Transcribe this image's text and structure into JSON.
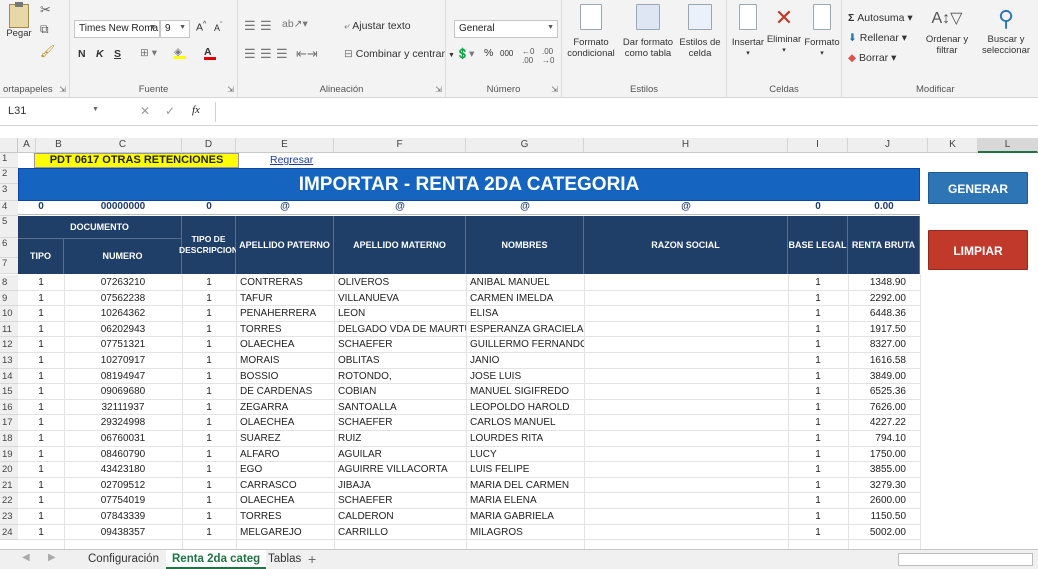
{
  "ribbon": {
    "clipboard": {
      "paste": "Pegar",
      "group": "ortapapeles"
    },
    "font": {
      "name": "Times New Roma",
      "size": "9",
      "bold": "N",
      "italic": "K",
      "underline": "S",
      "group": "Fuente"
    },
    "alignment": {
      "wrap": "Ajustar texto",
      "merge": "Combinar y centrar",
      "group": "Alineación"
    },
    "number": {
      "format": "General",
      "percent": "%",
      "thousands": "000",
      "group": "Número"
    },
    "styles": {
      "conditional": "Formato\ncondicional",
      "as_table": "Dar formato\ncomo tabla",
      "cell_styles": "Estilos de\ncelda",
      "group": "Estilos"
    },
    "cells": {
      "insert": "Insertar",
      "delete": "Eliminar",
      "format": "Formato",
      "group": "Celdas"
    },
    "editing": {
      "autosum": "Autosuma",
      "fill": "Rellenar",
      "clear": "Borrar",
      "sort": "Ordenar y\nfiltrar",
      "find": "Buscar y\nseleccionar",
      "group": "Modificar"
    }
  },
  "formula_bar": {
    "name_box": "L31",
    "fx": "fx"
  },
  "columns": [
    "A",
    "B",
    "C",
    "D",
    "E",
    "F",
    "G",
    "H",
    "I",
    "J",
    "K",
    "L"
  ],
  "sheet": {
    "pdt_title": "PDT 0617 OTRAS RETENCIONES",
    "regresar": "Regresar",
    "banner": "IMPORTAR - RENTA 2DA CATEGORIA",
    "row4": [
      "0",
      "00000000",
      "0",
      "@",
      "@",
      "@",
      "@",
      "0",
      "0.00"
    ],
    "headers": {
      "documento": "DOCUMENTO",
      "tipo": "TIPO",
      "numero": "NUMERO",
      "tipo_desc": "TIPO DE DESCRIPCION",
      "ap_paterno": "APELLIDO PATERNO",
      "ap_materno": "APELLIDO MATERNO",
      "nombres": "NOMBRES",
      "razon": "RAZON SOCIAL",
      "base": "BASE LEGAL",
      "renta": "RENTA BRUTA"
    },
    "buttons": {
      "generar": "GENERAR",
      "limpiar": "LIMPIAR"
    },
    "rows": [
      {
        "n": "8",
        "tipo": "1",
        "num": "07263210",
        "desc": "1",
        "pat": "CONTRERAS",
        "mat": "OLIVEROS",
        "nom": "ANIBAL MANUEL",
        "base": "1",
        "renta": "1348.90"
      },
      {
        "n": "9",
        "tipo": "1",
        "num": "07562238",
        "desc": "1",
        "pat": "TAFUR",
        "mat": "VILLANUEVA",
        "nom": "CARMEN IMELDA",
        "base": "1",
        "renta": "2292.00"
      },
      {
        "n": "10",
        "tipo": "1",
        "num": "10264362",
        "desc": "1",
        "pat": "PEÑAHERRERA",
        "mat": "LEON",
        "nom": "ELISA",
        "base": "1",
        "renta": "6448.36"
      },
      {
        "n": "11",
        "tipo": "1",
        "num": "06202943",
        "desc": "1",
        "pat": "TORRES",
        "mat": "DELGADO VDA DE MAURTUA",
        "nom": "ESPERANZA GRACIELA",
        "base": "1",
        "renta": "1917.50"
      },
      {
        "n": "12",
        "tipo": "1",
        "num": "07751321",
        "desc": "1",
        "pat": "OLAECHEA",
        "mat": "SCHAEFER",
        "nom": "GUILLERMO FERNANDO",
        "base": "1",
        "renta": "8327.00"
      },
      {
        "n": "13",
        "tipo": "1",
        "num": "10270917",
        "desc": "1",
        "pat": "MORAIS",
        "mat": "OBLITAS",
        "nom": "JANIO",
        "base": "1",
        "renta": "1616.58"
      },
      {
        "n": "14",
        "tipo": "1",
        "num": "08194947",
        "desc": "1",
        "pat": "BOSSIO",
        "mat": "ROTONDO,",
        "nom": "JOSE LUIS",
        "base": "1",
        "renta": "3849.00"
      },
      {
        "n": "15",
        "tipo": "1",
        "num": "09069680",
        "desc": "1",
        "pat": "DE CARDENAS",
        "mat": "COBIAN",
        "nom": "MANUEL SIGIFREDO",
        "base": "1",
        "renta": "6525.36"
      },
      {
        "n": "16",
        "tipo": "1",
        "num": "32111937",
        "desc": "1",
        "pat": "ZEGARRA",
        "mat": "SANTOALLA",
        "nom": "LEOPOLDO HAROLD",
        "base": "1",
        "renta": "7626.00"
      },
      {
        "n": "17",
        "tipo": "1",
        "num": "29324998",
        "desc": "1",
        "pat": "OLAECHEA",
        "mat": "SCHAEFER",
        "nom": "CARLOS MANUEL",
        "base": "1",
        "renta": "4227.22"
      },
      {
        "n": "18",
        "tipo": "1",
        "num": "06760031",
        "desc": "1",
        "pat": "SUAREZ",
        "mat": "RUIZ",
        "nom": "LOURDES RITA",
        "base": "1",
        "renta": "794.10"
      },
      {
        "n": "19",
        "tipo": "1",
        "num": "08460790",
        "desc": "1",
        "pat": "ALFARO",
        "mat": "AGUILAR",
        "nom": "LUCY",
        "base": "1",
        "renta": "1750.00"
      },
      {
        "n": "20",
        "tipo": "1",
        "num": "43423180",
        "desc": "1",
        "pat": "EGO",
        "mat": "AGUIRRE VILLACORTA",
        "nom": "LUIS FELIPE",
        "base": "1",
        "renta": "3855.00"
      },
      {
        "n": "21",
        "tipo": "1",
        "num": "02709512",
        "desc": "1",
        "pat": "CARRASCO",
        "mat": "JIBAJA",
        "nom": "MARIA DEL CARMEN",
        "base": "1",
        "renta": "3279.30"
      },
      {
        "n": "22",
        "tipo": "1",
        "num": "07754019",
        "desc": "1",
        "pat": "OLAECHEA",
        "mat": "SCHAEFER",
        "nom": "MARIA ELENA",
        "base": "1",
        "renta": "2600.00"
      },
      {
        "n": "23",
        "tipo": "1",
        "num": "07843339",
        "desc": "1",
        "pat": "TORRES",
        "mat": "CALDERON",
        "nom": "MARIA GABRIELA",
        "base": "1",
        "renta": "1150.50"
      },
      {
        "n": "24",
        "tipo": "1",
        "num": "09438357",
        "desc": "1",
        "pat": "MELGAREJO",
        "mat": "CARRILLO",
        "nom": "MILAGROS",
        "base": "1",
        "renta": "5002.00"
      }
    ]
  },
  "tabs": {
    "t1": "Configuración",
    "t2": "Renta 2da categ",
    "t3": "Tablas",
    "add": "+"
  },
  "colors": {
    "header_blue": "#1f3e68",
    "banner_blue": "#1565c0",
    "title_yellow": "#ffff00",
    "generar": "#2e75b6",
    "limpiar": "#c0392b"
  }
}
